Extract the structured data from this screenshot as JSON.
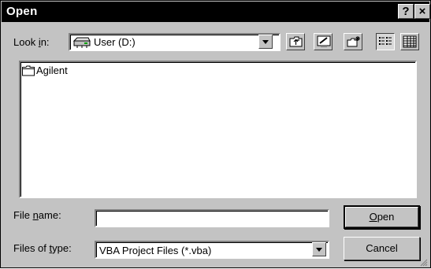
{
  "window": {
    "title": "Open",
    "help_glyph": "?",
    "close_glyph": "×"
  },
  "lookin": {
    "label_pre": "Look ",
    "label_key": "i",
    "label_post": "n:",
    "value": "User (D:)",
    "icon": "drive-icon"
  },
  "toolbar": {
    "buttons": [
      "up-one-level-icon",
      "desktop-icon",
      "new-folder-icon",
      "list-view-icon",
      "details-view-icon"
    ],
    "active": "list-view-icon"
  },
  "files": {
    "items": [
      {
        "name": "Agilent",
        "icon": "folder-icon"
      }
    ]
  },
  "filename": {
    "label_pre": "File ",
    "label_key": "n",
    "label_post": "ame:",
    "value": ""
  },
  "filetype": {
    "label_pre": "Files of ",
    "label_key": "t",
    "label_post": "ype:",
    "value": "VBA Project Files (*.vba)"
  },
  "buttons": {
    "open_key": "O",
    "open_rest": "pen",
    "cancel": "Cancel"
  },
  "colors": {
    "dialog_bg": "#c3c3c3",
    "titlebar_bg": "#000000",
    "titlebar_text": "#ffffff",
    "field_bg": "#ffffff"
  }
}
